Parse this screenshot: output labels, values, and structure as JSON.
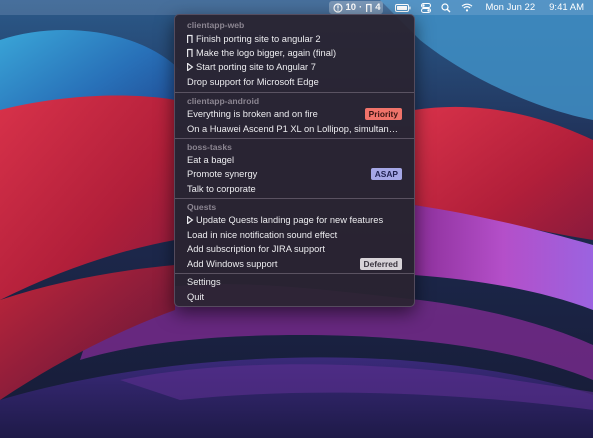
{
  "menubar": {
    "status": {
      "issues_count": "10",
      "separator": "·",
      "pr_count": "4"
    },
    "date": "Mon Jun 22",
    "time": "9:41 AM",
    "icons": [
      "alert-icon",
      "pull-request-icon",
      "battery-icon",
      "control-center-icon",
      "spotlight-search-icon",
      "wifi-icon"
    ]
  },
  "menu": {
    "sections": [
      {
        "title": "clientapp-web",
        "items": [
          {
            "label": "Finish porting site to angular 2",
            "icon": "pull-request-icon"
          },
          {
            "label": "Make the logo bigger, again (final)",
            "icon": "pull-request-icon"
          },
          {
            "label": "Start porting site to Angular 7",
            "icon": "draft-pull-request-icon"
          },
          {
            "label": "Drop support for Microsoft Edge",
            "icon": ""
          }
        ]
      },
      {
        "title": "clientapp-android",
        "items": [
          {
            "label": "Everything is broken and on fire",
            "badge": "Priority"
          },
          {
            "label": "On a Huawei Ascend P1 XL on Lollipop, simultaneous..."
          }
        ]
      },
      {
        "title": "boss-tasks",
        "items": [
          {
            "label": "Eat a bagel"
          },
          {
            "label": "Promote synergy",
            "badge": "ASAP"
          },
          {
            "label": "Talk to corporate"
          }
        ]
      },
      {
        "title": "Quests",
        "items": [
          {
            "label": "Update Quests landing page for new features",
            "icon": "draft-pull-request-icon"
          },
          {
            "label": "Load in nice notification sound effect"
          },
          {
            "label": "Add subscription for JIRA support"
          },
          {
            "label": "Add Windows support",
            "badge": "Deferred"
          }
        ]
      }
    ],
    "footer": {
      "settings_label": "Settings",
      "quit_label": "Quit"
    }
  },
  "colors": {
    "priority_badge": "#f0736a",
    "asap_badge": "#a5a7e6",
    "deferred_badge": "#d7d3d8",
    "section_title": "#8b8591"
  }
}
